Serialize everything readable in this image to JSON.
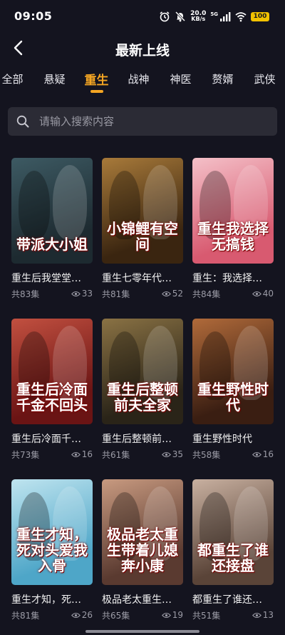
{
  "status_bar": {
    "time": "09:05",
    "net_speed_value": "20.0",
    "net_speed_unit": "KB/s",
    "signal_label": "5G",
    "battery": "100"
  },
  "header": {
    "title": "最新上线"
  },
  "tabs": [
    {
      "label": "全部",
      "active": false
    },
    {
      "label": "悬疑",
      "active": false
    },
    {
      "label": "重生",
      "active": true
    },
    {
      "label": "战神",
      "active": false
    },
    {
      "label": "神医",
      "active": false
    },
    {
      "label": "赘婿",
      "active": false
    },
    {
      "label": "武侠",
      "active": false
    }
  ],
  "search": {
    "placeholder": "请输入搜索内容"
  },
  "cards": [
    {
      "title": "重生后我堂堂…",
      "episodes": "共83集",
      "views": "33",
      "poster_text": "带派大小姐",
      "colors": [
        "#1d2a30",
        "#3d5a63"
      ]
    },
    {
      "title": "重生七零年代…",
      "episodes": "共81集",
      "views": "52",
      "poster_text": "小锦鲤有空间",
      "colors": [
        "#3a2510",
        "#a87a3a"
      ]
    },
    {
      "title": "重生：我选择…",
      "episodes": "共84集",
      "views": "40",
      "poster_text": "重生我选择无搞钱",
      "colors": [
        "#d85a70",
        "#f4c0c8"
      ]
    },
    {
      "title": "重生后冷面千…",
      "episodes": "共73集",
      "views": "16",
      "poster_text": "重生后冷面千金不回头",
      "colors": [
        "#6a1414",
        "#c25040"
      ]
    },
    {
      "title": "重生后整顿前…",
      "episodes": "共61集",
      "views": "35",
      "poster_text": "重生后整顿前夫全家",
      "colors": [
        "#2a2418",
        "#8a7244"
      ]
    },
    {
      "title": "重生野性时代",
      "episodes": "共58集",
      "views": "16",
      "poster_text": "重生野性时代",
      "colors": [
        "#3a1e12",
        "#b06a3a"
      ]
    },
    {
      "title": "重生才知，死…",
      "episodes": "共81集",
      "views": "26",
      "poster_text": "重生才知，死对头爱我入骨",
      "colors": [
        "#4ea6c8",
        "#bfe4ef"
      ]
    },
    {
      "title": "极品老太重生…",
      "episodes": "共65集",
      "views": "19",
      "poster_text": "极品老太重生带着儿媳奔小康",
      "colors": [
        "#5a3a30",
        "#c89a80"
      ]
    },
    {
      "title": "都重生了谁还…",
      "episodes": "共51集",
      "views": "13",
      "poster_text": "都重生了谁还接盘",
      "colors": [
        "#5a4438",
        "#c8b0a0"
      ]
    }
  ]
}
